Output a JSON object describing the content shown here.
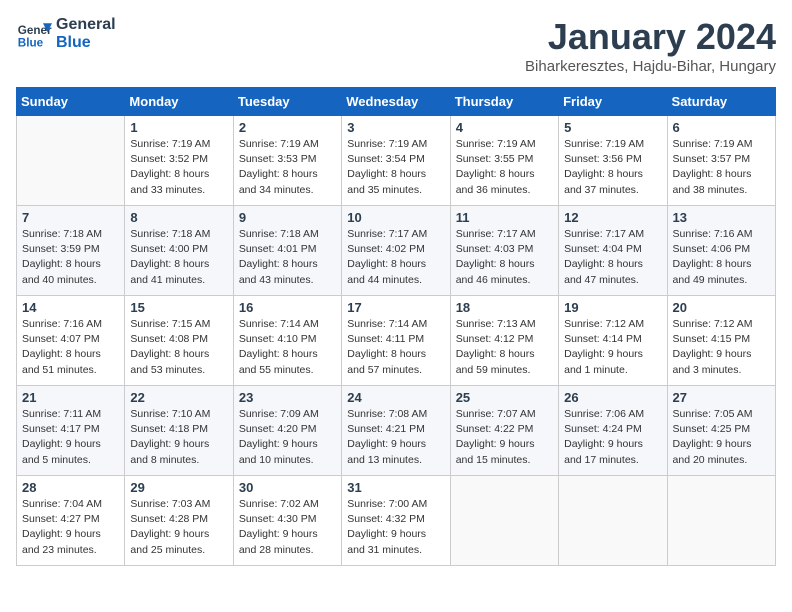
{
  "logo": {
    "line1": "General",
    "line2": "Blue"
  },
  "title": "January 2024",
  "location": "Biharkeresztes, Hajdu-Bihar, Hungary",
  "headers": [
    "Sunday",
    "Monday",
    "Tuesday",
    "Wednesday",
    "Thursday",
    "Friday",
    "Saturday"
  ],
  "weeks": [
    [
      {
        "day": "",
        "sunrise": "",
        "sunset": "",
        "daylight": ""
      },
      {
        "day": "1",
        "sunrise": "Sunrise: 7:19 AM",
        "sunset": "Sunset: 3:52 PM",
        "daylight": "Daylight: 8 hours and 33 minutes."
      },
      {
        "day": "2",
        "sunrise": "Sunrise: 7:19 AM",
        "sunset": "Sunset: 3:53 PM",
        "daylight": "Daylight: 8 hours and 34 minutes."
      },
      {
        "day": "3",
        "sunrise": "Sunrise: 7:19 AM",
        "sunset": "Sunset: 3:54 PM",
        "daylight": "Daylight: 8 hours and 35 minutes."
      },
      {
        "day": "4",
        "sunrise": "Sunrise: 7:19 AM",
        "sunset": "Sunset: 3:55 PM",
        "daylight": "Daylight: 8 hours and 36 minutes."
      },
      {
        "day": "5",
        "sunrise": "Sunrise: 7:19 AM",
        "sunset": "Sunset: 3:56 PM",
        "daylight": "Daylight: 8 hours and 37 minutes."
      },
      {
        "day": "6",
        "sunrise": "Sunrise: 7:19 AM",
        "sunset": "Sunset: 3:57 PM",
        "daylight": "Daylight: 8 hours and 38 minutes."
      }
    ],
    [
      {
        "day": "7",
        "sunrise": "Sunrise: 7:18 AM",
        "sunset": "Sunset: 3:59 PM",
        "daylight": "Daylight: 8 hours and 40 minutes."
      },
      {
        "day": "8",
        "sunrise": "Sunrise: 7:18 AM",
        "sunset": "Sunset: 4:00 PM",
        "daylight": "Daylight: 8 hours and 41 minutes."
      },
      {
        "day": "9",
        "sunrise": "Sunrise: 7:18 AM",
        "sunset": "Sunset: 4:01 PM",
        "daylight": "Daylight: 8 hours and 43 minutes."
      },
      {
        "day": "10",
        "sunrise": "Sunrise: 7:17 AM",
        "sunset": "Sunset: 4:02 PM",
        "daylight": "Daylight: 8 hours and 44 minutes."
      },
      {
        "day": "11",
        "sunrise": "Sunrise: 7:17 AM",
        "sunset": "Sunset: 4:03 PM",
        "daylight": "Daylight: 8 hours and 46 minutes."
      },
      {
        "day": "12",
        "sunrise": "Sunrise: 7:17 AM",
        "sunset": "Sunset: 4:04 PM",
        "daylight": "Daylight: 8 hours and 47 minutes."
      },
      {
        "day": "13",
        "sunrise": "Sunrise: 7:16 AM",
        "sunset": "Sunset: 4:06 PM",
        "daylight": "Daylight: 8 hours and 49 minutes."
      }
    ],
    [
      {
        "day": "14",
        "sunrise": "Sunrise: 7:16 AM",
        "sunset": "Sunset: 4:07 PM",
        "daylight": "Daylight: 8 hours and 51 minutes."
      },
      {
        "day": "15",
        "sunrise": "Sunrise: 7:15 AM",
        "sunset": "Sunset: 4:08 PM",
        "daylight": "Daylight: 8 hours and 53 minutes."
      },
      {
        "day": "16",
        "sunrise": "Sunrise: 7:14 AM",
        "sunset": "Sunset: 4:10 PM",
        "daylight": "Daylight: 8 hours and 55 minutes."
      },
      {
        "day": "17",
        "sunrise": "Sunrise: 7:14 AM",
        "sunset": "Sunset: 4:11 PM",
        "daylight": "Daylight: 8 hours and 57 minutes."
      },
      {
        "day": "18",
        "sunrise": "Sunrise: 7:13 AM",
        "sunset": "Sunset: 4:12 PM",
        "daylight": "Daylight: 8 hours and 59 minutes."
      },
      {
        "day": "19",
        "sunrise": "Sunrise: 7:12 AM",
        "sunset": "Sunset: 4:14 PM",
        "daylight": "Daylight: 9 hours and 1 minute."
      },
      {
        "day": "20",
        "sunrise": "Sunrise: 7:12 AM",
        "sunset": "Sunset: 4:15 PM",
        "daylight": "Daylight: 9 hours and 3 minutes."
      }
    ],
    [
      {
        "day": "21",
        "sunrise": "Sunrise: 7:11 AM",
        "sunset": "Sunset: 4:17 PM",
        "daylight": "Daylight: 9 hours and 5 minutes."
      },
      {
        "day": "22",
        "sunrise": "Sunrise: 7:10 AM",
        "sunset": "Sunset: 4:18 PM",
        "daylight": "Daylight: 9 hours and 8 minutes."
      },
      {
        "day": "23",
        "sunrise": "Sunrise: 7:09 AM",
        "sunset": "Sunset: 4:20 PM",
        "daylight": "Daylight: 9 hours and 10 minutes."
      },
      {
        "day": "24",
        "sunrise": "Sunrise: 7:08 AM",
        "sunset": "Sunset: 4:21 PM",
        "daylight": "Daylight: 9 hours and 13 minutes."
      },
      {
        "day": "25",
        "sunrise": "Sunrise: 7:07 AM",
        "sunset": "Sunset: 4:22 PM",
        "daylight": "Daylight: 9 hours and 15 minutes."
      },
      {
        "day": "26",
        "sunrise": "Sunrise: 7:06 AM",
        "sunset": "Sunset: 4:24 PM",
        "daylight": "Daylight: 9 hours and 17 minutes."
      },
      {
        "day": "27",
        "sunrise": "Sunrise: 7:05 AM",
        "sunset": "Sunset: 4:25 PM",
        "daylight": "Daylight: 9 hours and 20 minutes."
      }
    ],
    [
      {
        "day": "28",
        "sunrise": "Sunrise: 7:04 AM",
        "sunset": "Sunset: 4:27 PM",
        "daylight": "Daylight: 9 hours and 23 minutes."
      },
      {
        "day": "29",
        "sunrise": "Sunrise: 7:03 AM",
        "sunset": "Sunset: 4:28 PM",
        "daylight": "Daylight: 9 hours and 25 minutes."
      },
      {
        "day": "30",
        "sunrise": "Sunrise: 7:02 AM",
        "sunset": "Sunset: 4:30 PM",
        "daylight": "Daylight: 9 hours and 28 minutes."
      },
      {
        "day": "31",
        "sunrise": "Sunrise: 7:00 AM",
        "sunset": "Sunset: 4:32 PM",
        "daylight": "Daylight: 9 hours and 31 minutes."
      },
      {
        "day": "",
        "sunrise": "",
        "sunset": "",
        "daylight": ""
      },
      {
        "day": "",
        "sunrise": "",
        "sunset": "",
        "daylight": ""
      },
      {
        "day": "",
        "sunrise": "",
        "sunset": "",
        "daylight": ""
      }
    ]
  ]
}
